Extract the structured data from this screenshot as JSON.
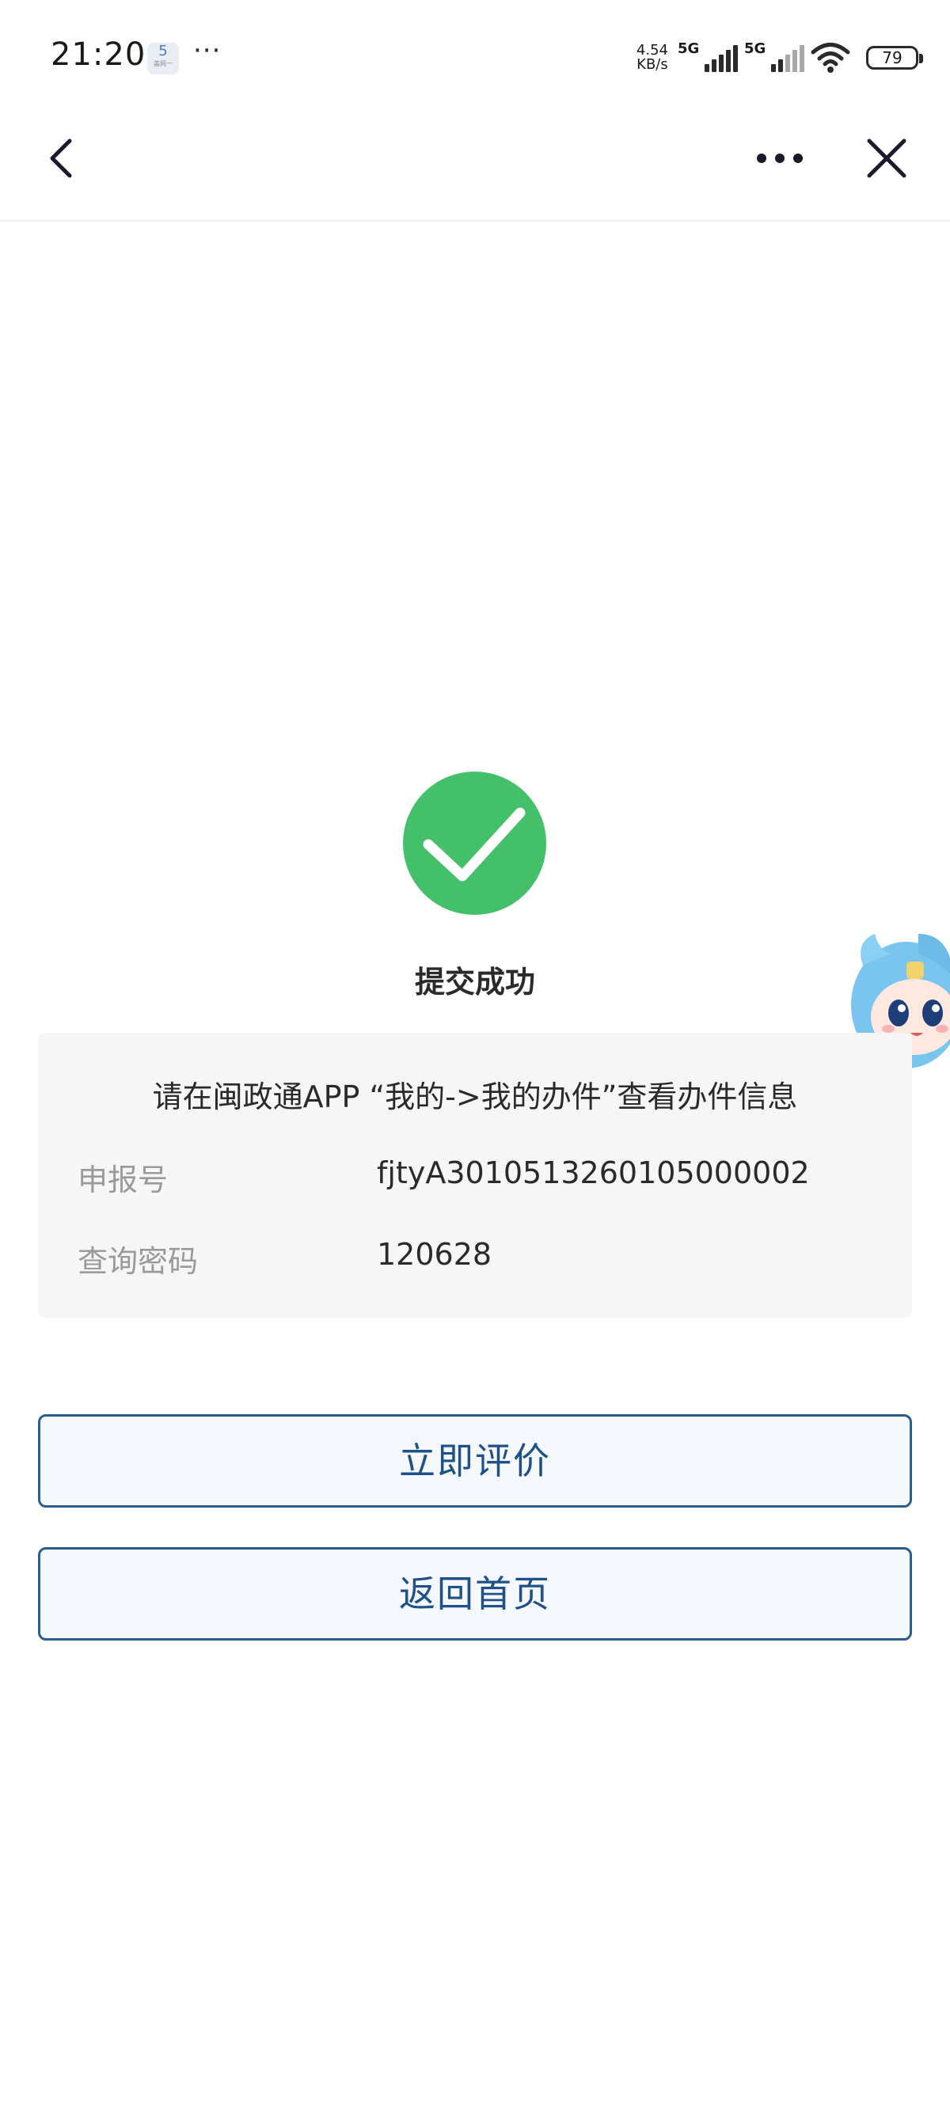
{
  "status_bar": {
    "time": "21:20",
    "app_badge": "5",
    "app_badge_sub": "盖网一",
    "more": "···",
    "net_speed_value": "4.54",
    "net_speed_unit": "KB/s",
    "signal_1_label": "5G",
    "signal_2_label": "5G",
    "battery": "79"
  },
  "nav": {
    "back_icon": "chevron-left-icon",
    "more_icon": "more-horizontal-icon",
    "close_icon": "close-icon"
  },
  "result": {
    "icon": "check-circle-icon",
    "icon_color": "#44bf6a",
    "title": "提交成功"
  },
  "info": {
    "hint": "请在闽政通APP “我的->我的办件”查看办件信息",
    "rows": [
      {
        "label": "申报号",
        "value": "fjtyA3010513260105000002"
      },
      {
        "label": "查询密码",
        "value": "120628"
      }
    ]
  },
  "actions": {
    "rate_label": "立即评价",
    "home_label": "返回首页",
    "accent_color": "#2a5c8f"
  }
}
